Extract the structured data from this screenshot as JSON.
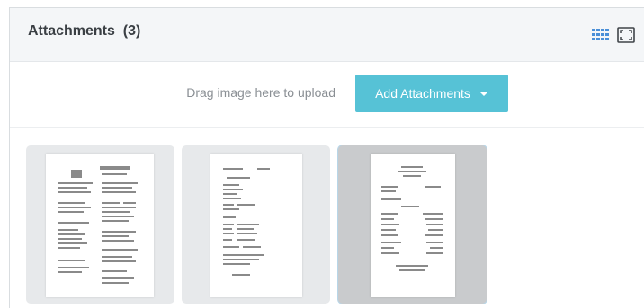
{
  "header": {
    "title": "Attachments",
    "count": "(3)",
    "grid_icon": "grid-view-icon",
    "fullscreen_icon": "fullscreen-icon",
    "accent": "#56c2d6"
  },
  "toolbar": {
    "drag_text": "Drag image here to upload",
    "add_button_label": "Add Attachments",
    "add_button_color": "#56c2d6"
  },
  "attachments": [
    {
      "kind": "document-scan",
      "selected": false
    },
    {
      "kind": "document-scan",
      "selected": false
    },
    {
      "kind": "document-scan",
      "selected": true
    }
  ]
}
